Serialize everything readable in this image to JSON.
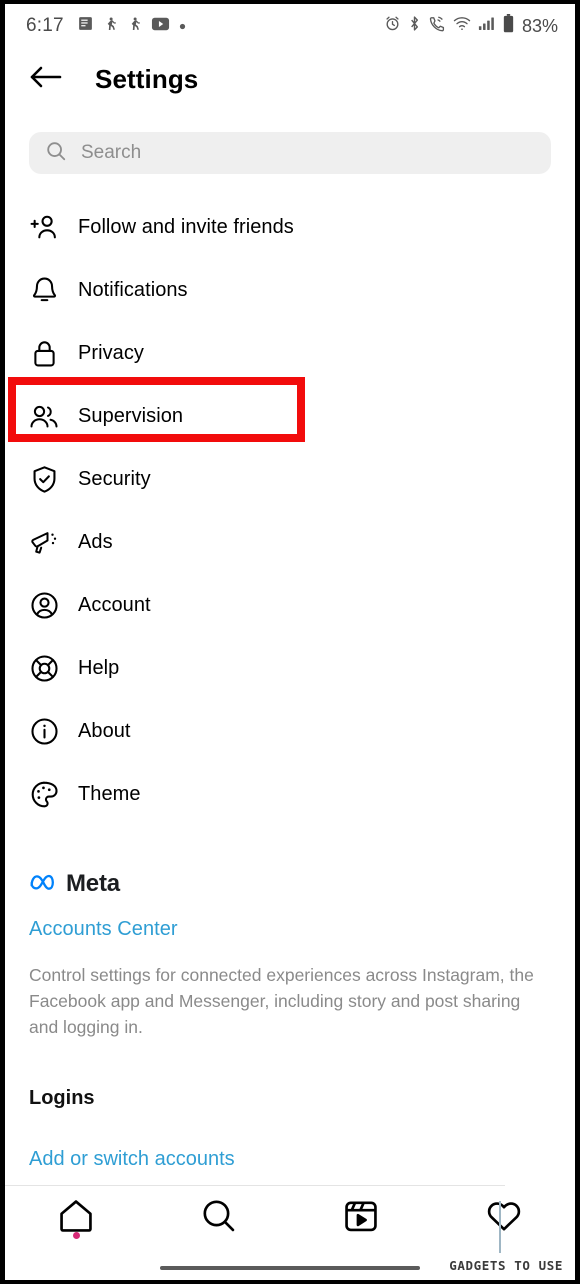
{
  "status_bar": {
    "time": "6:17",
    "battery_percent": "83%",
    "left_icons": [
      "list-notification-icon",
      "walking-person-icon",
      "walking-person-icon",
      "youtube-icon",
      "dot-icon"
    ],
    "right_icons": [
      "alarm-icon",
      "bluetooth-icon",
      "call-icon",
      "wifi-icon",
      "cellular-signal-icon",
      "battery-icon"
    ]
  },
  "header": {
    "back_icon": "back-arrow-icon",
    "title": "Settings"
  },
  "search": {
    "icon": "search-icon",
    "placeholder": "Search",
    "value": ""
  },
  "menu": {
    "items": [
      {
        "label": "Follow and invite friends",
        "icon": "person-add-icon",
        "highlighted": false
      },
      {
        "label": "Notifications",
        "icon": "bell-icon",
        "highlighted": false
      },
      {
        "label": "Privacy",
        "icon": "lock-icon",
        "highlighted": false
      },
      {
        "label": "Supervision",
        "icon": "people-icon",
        "highlighted": true
      },
      {
        "label": "Security",
        "icon": "shield-check-icon",
        "highlighted": false
      },
      {
        "label": "Ads",
        "icon": "megaphone-icon",
        "highlighted": false
      },
      {
        "label": "Account",
        "icon": "account-circle-icon",
        "highlighted": false
      },
      {
        "label": "Help",
        "icon": "life-ring-icon",
        "highlighted": false
      },
      {
        "label": "About",
        "icon": "info-circle-icon",
        "highlighted": false
      },
      {
        "label": "Theme",
        "icon": "palette-icon",
        "highlighted": false
      }
    ]
  },
  "meta_section": {
    "logo_icon": "meta-infinity-icon",
    "brand": "Meta",
    "link": "Accounts Center",
    "description": "Control settings for connected experiences across Instagram, the Facebook app and Messenger, including story and post sharing and logging in."
  },
  "logins_section": {
    "title": "Logins",
    "link": "Add or switch accounts"
  },
  "bottom_nav": {
    "items": [
      {
        "icon": "home-icon",
        "badge": true
      },
      {
        "icon": "search-icon",
        "badge": false
      },
      {
        "icon": "reels-icon",
        "badge": false
      },
      {
        "icon": "heart-icon",
        "badge": false
      }
    ]
  },
  "watermark": {
    "text": "GADGETS TO USE"
  },
  "colors": {
    "highlight": "#f20c0c",
    "link": "#2f9ed4",
    "meta_blue": "#0082fb",
    "badge": "#d62976",
    "muted_text": "#8a8a8a"
  }
}
